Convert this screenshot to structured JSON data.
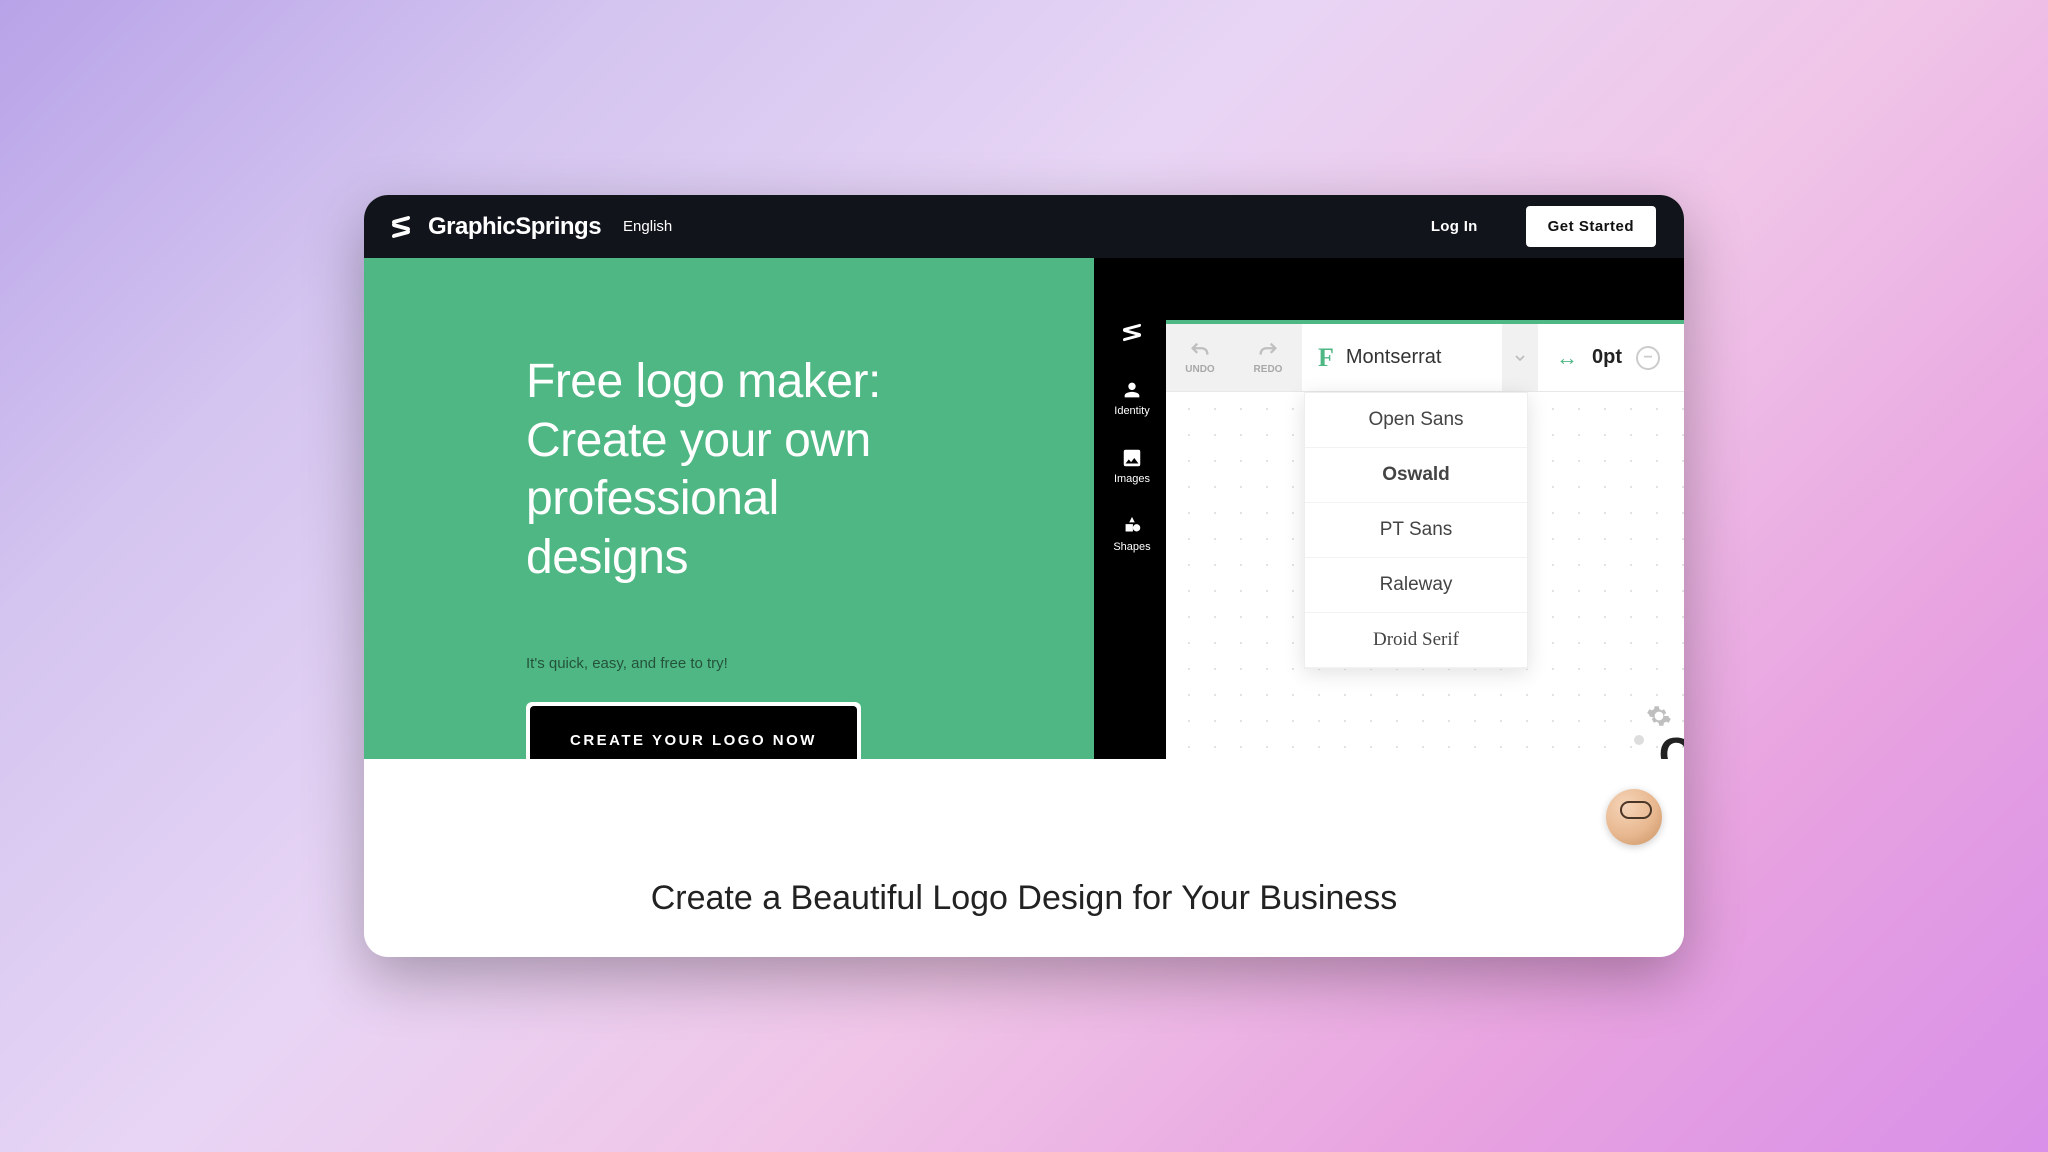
{
  "header": {
    "brand": "GraphicSprings",
    "language": "English",
    "login": "Log In",
    "get_started": "Get Started"
  },
  "hero": {
    "title": "Free logo maker: Create your own professional designs",
    "subtitle": "It's quick, easy, and free to try!",
    "cta": "CREATE YOUR LOGO NOW"
  },
  "editor": {
    "sidebar": {
      "identity": "Identity",
      "images": "Images",
      "shapes": "Shapes"
    },
    "toolbar": {
      "undo": "UNDO",
      "redo": "REDO",
      "font_selected": "Montserrat",
      "spacing_value": "0pt"
    },
    "font_options": [
      "Open Sans",
      "Oswald",
      "PT Sans",
      "Raleway",
      "Droid Serif"
    ]
  },
  "section2": {
    "title": "Create a Beautiful Logo Design for Your Business"
  }
}
